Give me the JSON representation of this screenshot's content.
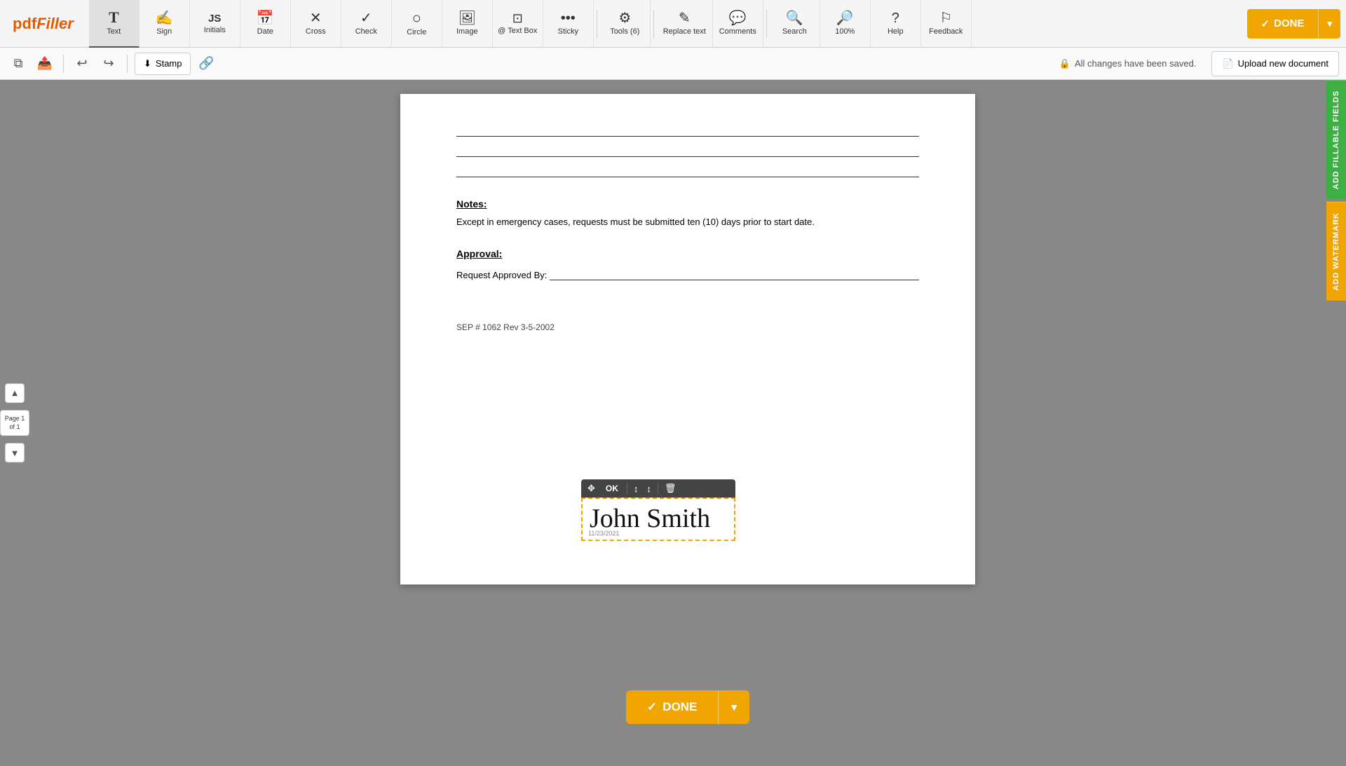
{
  "logo": {
    "text1": "pdf",
    "text2": "Filler"
  },
  "toolbar": {
    "tools": [
      {
        "id": "text",
        "icon": "T",
        "label": "Text",
        "active": true
      },
      {
        "id": "sign",
        "icon": "✍",
        "label": "Sign",
        "active": false
      },
      {
        "id": "initials",
        "icon": "JS",
        "label": "Initials",
        "active": false
      },
      {
        "id": "date",
        "icon": "📅",
        "label": "Date",
        "active": false
      },
      {
        "id": "cross",
        "icon": "✕",
        "label": "Cross",
        "active": false
      },
      {
        "id": "check",
        "icon": "✓",
        "label": "Check",
        "active": false
      },
      {
        "id": "circle",
        "icon": "○",
        "label": "Circle",
        "active": false
      },
      {
        "id": "image",
        "icon": "🖼",
        "label": "Image",
        "active": false
      },
      {
        "id": "textbox",
        "icon": "⊡",
        "label": "Text Box",
        "active": false
      },
      {
        "id": "sticky",
        "icon": "…",
        "label": "Sticky",
        "active": false
      },
      {
        "id": "tools6",
        "icon": "⚙",
        "label": "Tools (6)",
        "active": false
      },
      {
        "id": "replace",
        "icon": "✎",
        "label": "Replace text",
        "active": false
      },
      {
        "id": "comments",
        "icon": "💬",
        "label": "Comments",
        "active": false
      },
      {
        "id": "search",
        "icon": "🔍",
        "label": "Search",
        "active": false
      },
      {
        "id": "zoom",
        "icon": "100%",
        "label": "100%",
        "active": false
      },
      {
        "id": "help",
        "icon": "?",
        "label": "Help",
        "active": false
      },
      {
        "id": "feedback",
        "icon": "⚐",
        "label": "Feedback",
        "active": false
      }
    ],
    "done_label": "DONE"
  },
  "secondary_toolbar": {
    "stamp_label": "Stamp",
    "autosave_msg": "All changes have been saved.",
    "upload_label": "Upload new document"
  },
  "page_nav": {
    "page_label": "Page 1 of 1",
    "up_title": "Previous page",
    "down_title": "Next page"
  },
  "document": {
    "lines": 3,
    "notes_title": "Notes:",
    "notes_text": "Except in emergency cases, requests must be submitted ten (10) days prior to start date.",
    "approval_title": "Approval:",
    "approval_label": "Request Approved By:",
    "footer_text": "SEP # 1062 Rev 3-5-2002"
  },
  "signature": {
    "text": "John Smith",
    "date": "11/23/2021",
    "ok_label": "OK"
  },
  "right_panel": {
    "fillable_label": "ADD FILLABLE FIELDS",
    "watermark_label": "ADD WATERMARK"
  },
  "bottom_done": {
    "label": "DONE"
  }
}
